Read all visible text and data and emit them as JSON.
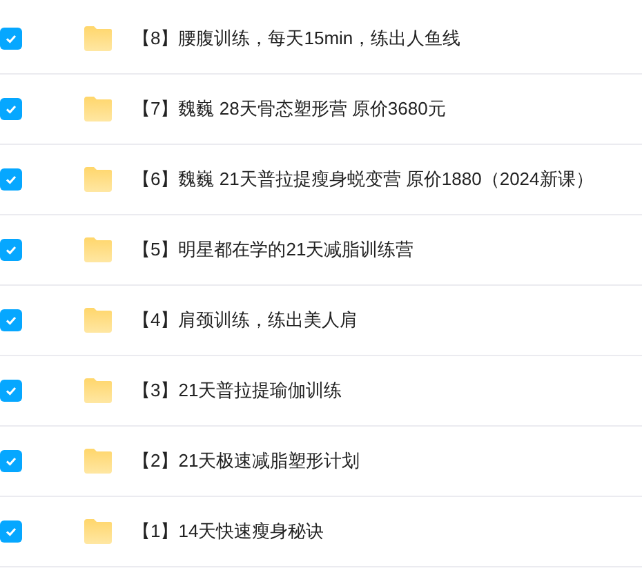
{
  "items": [
    {
      "name": "【8】腰腹训练，每天15min，练出人鱼线",
      "checked": true
    },
    {
      "name": "【7】魏巍 28天骨态塑形营 原价3680元",
      "checked": true
    },
    {
      "name": "【6】魏巍 21天普拉提瘦身蜕变营 原价1880（2024新课）",
      "checked": true
    },
    {
      "name": "【5】明星都在学的21天减脂训练营",
      "checked": true
    },
    {
      "name": "【4】肩颈训练，练出美人肩",
      "checked": true
    },
    {
      "name": "【3】21天普拉提瑜伽训练",
      "checked": true
    },
    {
      "name": "【2】21天极速减脂塑形计划",
      "checked": true
    },
    {
      "name": "【1】14天快速瘦身秘诀",
      "checked": true
    }
  ]
}
